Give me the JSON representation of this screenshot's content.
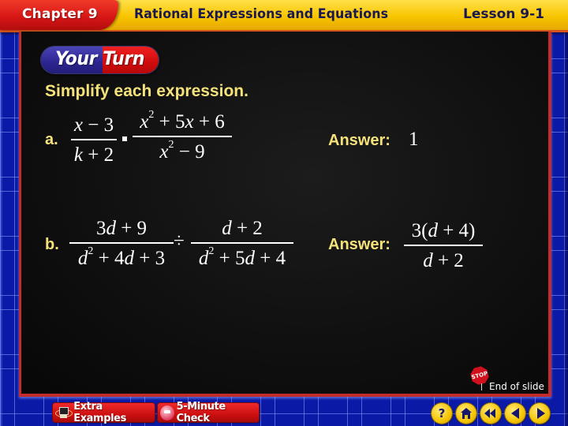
{
  "header": {
    "chapter": "Chapter 9",
    "title": "Rational Expressions and Equations",
    "lesson": "Lesson 9-1"
  },
  "badge": {
    "label": "Your Turn"
  },
  "instructions": "Simplify each expression.",
  "problems": [
    {
      "label": "a.",
      "expression": {
        "left_fraction": {
          "numerator": "x − 3",
          "denominator": "k + 2"
        },
        "operator": "multiply-dot",
        "right_fraction": {
          "numerator": "x² + 5x + 6",
          "denominator": "x² − 9"
        }
      },
      "answer_label": "Answer:",
      "answer": "1"
    },
    {
      "label": "b.",
      "expression": {
        "left_fraction": {
          "numerator": "3d + 9",
          "denominator": "d² + 4d + 3"
        },
        "operator": "÷",
        "right_fraction": {
          "numerator": "d + 2",
          "denominator": "d² + 5d + 4"
        }
      },
      "answer_label": "Answer:",
      "answer": {
        "numerator": "3(d + 4)",
        "denominator": "d + 2"
      }
    }
  ],
  "end_of_slide": {
    "icon": "stop-sign-icon",
    "stop_text": "STOP",
    "label": "End of slide"
  },
  "footer": {
    "buttons": [
      {
        "label": "Extra Examples",
        "icon": "computer-icon"
      },
      {
        "label": "5-Minute Check",
        "icon": "clock-icon"
      }
    ],
    "nav": [
      {
        "name": "help",
        "glyph": "?"
      },
      {
        "name": "home",
        "glyph": "home"
      },
      {
        "name": "first",
        "glyph": "rewind"
      },
      {
        "name": "previous",
        "glyph": "left"
      },
      {
        "name": "next",
        "glyph": "right"
      }
    ]
  },
  "colors": {
    "header_yellow": "#f8c500",
    "chapter_red": "#d41515",
    "title_navy": "#1a1850",
    "frame_blue": "#0b1aa6",
    "slide_border_red": "#c32c2c",
    "label_yellow": "#f5e27a",
    "nav_gold": "#f5c400"
  }
}
